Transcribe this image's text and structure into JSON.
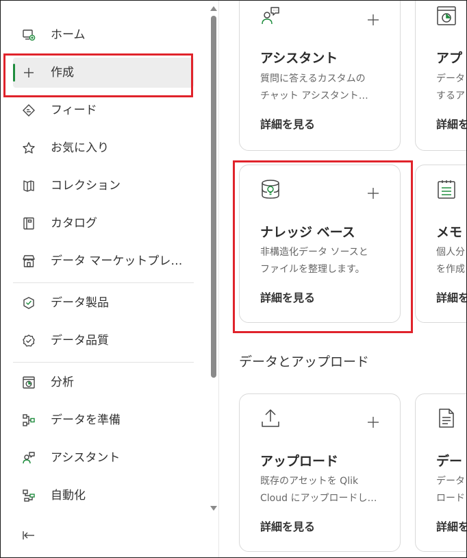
{
  "sidebar": {
    "items": [
      {
        "label": "ホーム",
        "icon": "home-icon"
      },
      {
        "label": "作成",
        "icon": "plus-icon"
      },
      {
        "label": "フィード",
        "icon": "feed-icon"
      },
      {
        "label": "お気に入り",
        "icon": "star-icon"
      },
      {
        "label": "コレクション",
        "icon": "collection-icon"
      },
      {
        "label": "カタログ",
        "icon": "catalog-icon"
      },
      {
        "label": "データ マーケットプレイス",
        "icon": "marketplace-icon"
      },
      {
        "label": "データ製品",
        "icon": "data-product-icon"
      },
      {
        "label": "データ品質",
        "icon": "data-quality-icon"
      },
      {
        "label": "分析",
        "icon": "analytics-icon"
      },
      {
        "label": "データを準備",
        "icon": "prepare-data-icon"
      },
      {
        "label": "アシスタント",
        "icon": "assistant-icon"
      },
      {
        "label": "自動化",
        "icon": "automation-icon"
      }
    ],
    "active_item": "作成"
  },
  "cards": {
    "assistant": {
      "title": "アシスタント",
      "desc_line1": "質問に答えるカスタムの",
      "desc_line2": "チャット アシスタント…",
      "link": "詳細を見る"
    },
    "app": {
      "title": "アプ",
      "desc_line1": "データ",
      "desc_line2": "するア",
      "link": "詳細を"
    },
    "knowledge": {
      "title": "ナレッジ ベース",
      "desc_line1": "非構造化データ ソースと",
      "desc_line2": "ファイルを整理します。",
      "link": "詳細を見る"
    },
    "memo": {
      "title": "メモ",
      "desc_line1": "個人分",
      "desc_line2": "を作成",
      "link": "詳細を"
    },
    "upload": {
      "title": "アップロード",
      "desc_line1": "既存のアセットを Qlik",
      "desc_line2": "Cloud にアップロードし…",
      "link": "詳細を見る"
    },
    "data": {
      "title": "デー",
      "desc_line1": "データ",
      "desc_line2": "ロード",
      "link": "詳細を"
    }
  },
  "section": {
    "title": "データとアップロード"
  },
  "colors": {
    "accent": "#1f8d3e",
    "highlight": "#e0232b",
    "active_bg": "#ededed"
  }
}
